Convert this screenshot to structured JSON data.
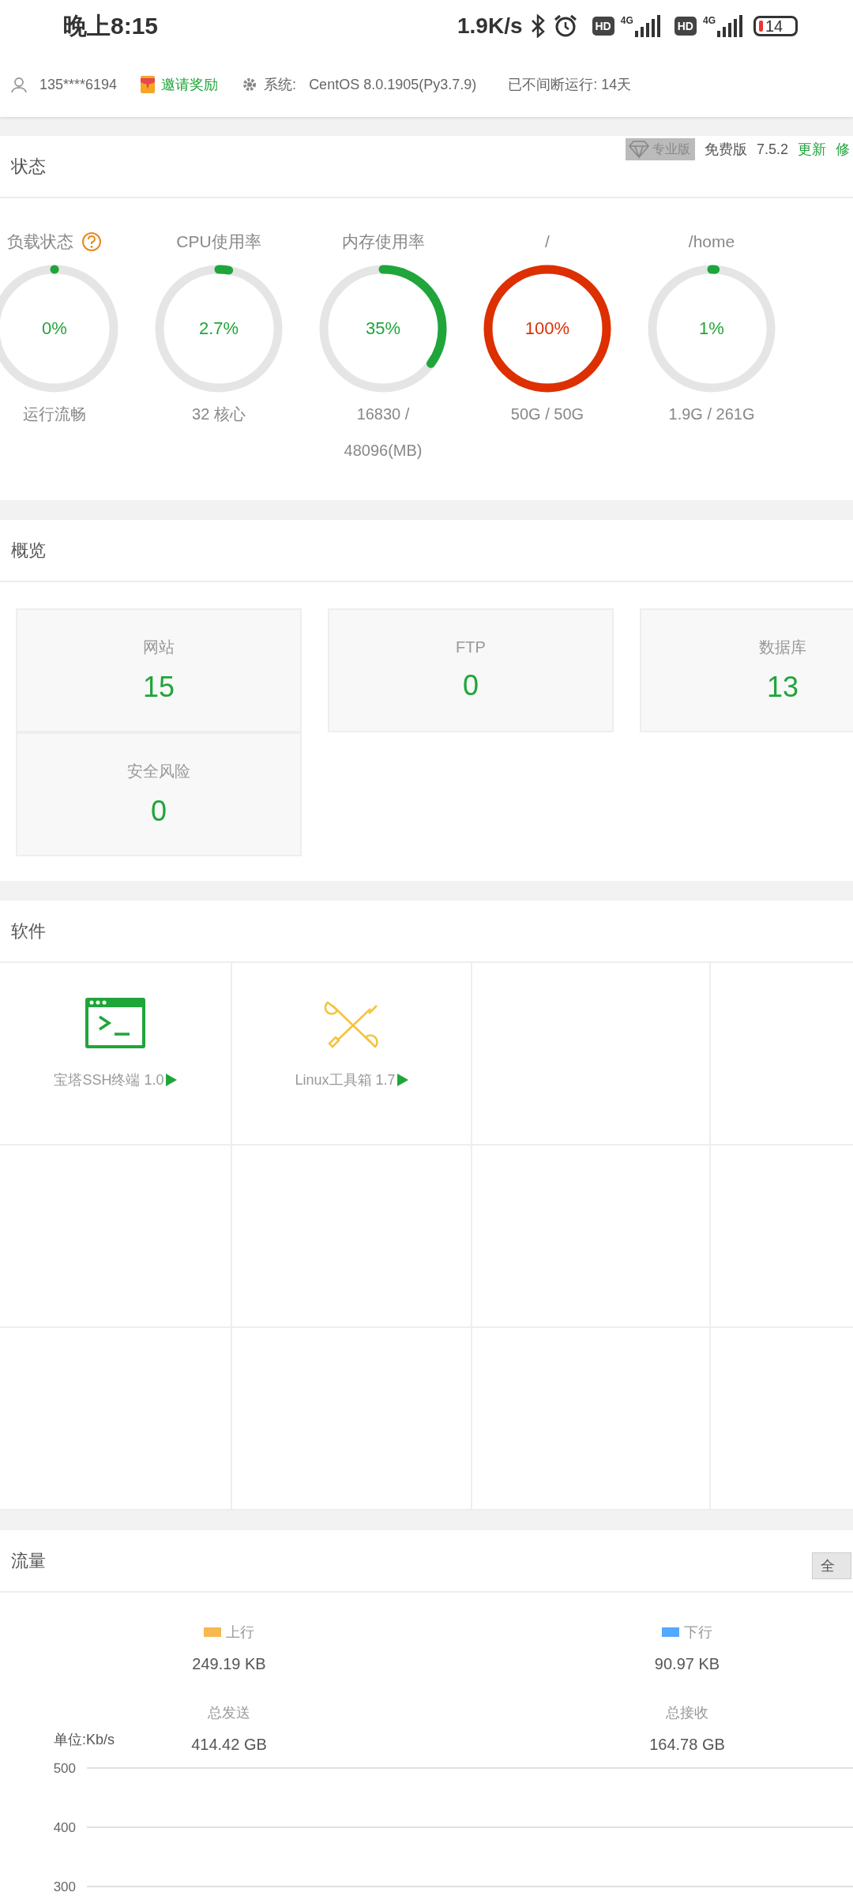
{
  "status_bar": {
    "time": "晚上8:15",
    "net_speed": "1.9K/s",
    "sims": [
      {
        "hd": "HD",
        "network": "4G"
      },
      {
        "hd": "HD",
        "network": "4G"
      }
    ],
    "battery": "14"
  },
  "account_bar": {
    "phone": "135****6194",
    "invite": "邀请奖励",
    "system_label": "系统:",
    "system": "CentOS 8.0.1905(Py3.7.9)",
    "uptime": "已不间断运行: 14天"
  },
  "status": {
    "title": "状态",
    "edition": {
      "pro": "专业版",
      "free": "免费版",
      "version": "7.5.2",
      "update": "更新",
      "repair": "修"
    },
    "gauges": [
      {
        "label": "负载状态",
        "help": true,
        "value": "0%",
        "level": 0,
        "color": "#20a53a",
        "details": "运行流畅"
      },
      {
        "label": "CPU使用率",
        "help": false,
        "value": "2.7%",
        "level": 0.027,
        "color": "#20a53a",
        "details": "32 核心"
      },
      {
        "label": "内存使用率",
        "help": false,
        "value": "35%",
        "level": 0.35,
        "color": "#20a53a",
        "details": "16830 / 48096(MB)"
      },
      {
        "label": "/",
        "help": false,
        "value": "100%",
        "level": 1,
        "color": "#dd2f00",
        "details": "50G / 50G"
      },
      {
        "label": "/home",
        "help": false,
        "value": "1%",
        "level": 0.01,
        "color": "#20a53a",
        "details": "1.9G / 261G"
      }
    ]
  },
  "overview": {
    "title": "概览",
    "cards": [
      {
        "label": "网站",
        "value": "15"
      },
      {
        "label": "FTP",
        "value": "0"
      },
      {
        "label": "数据库",
        "value": "13"
      },
      {
        "label": "安全风险",
        "value": "0"
      }
    ]
  },
  "software": {
    "title": "软件",
    "items": [
      {
        "kind": "terminal",
        "name": "宝塔SSH终端 1.0"
      },
      {
        "kind": "tools",
        "name": "Linux工具箱 1.7"
      }
    ]
  },
  "traffic": {
    "title": "流量",
    "all_button": "全",
    "stats": [
      {
        "label": "上行",
        "color": "#f7b851",
        "value": "249.19 KB",
        "total_label": "总发送",
        "total": "414.42 GB"
      },
      {
        "label": "下行",
        "color": "#52a9ff",
        "value": "90.97 KB",
        "total_label": "总接收",
        "total": "164.78 GB"
      }
    ],
    "chart": {
      "unit": "单位:Kb/s",
      "y_ticks": [
        "500",
        "400",
        "300"
      ]
    }
  }
}
